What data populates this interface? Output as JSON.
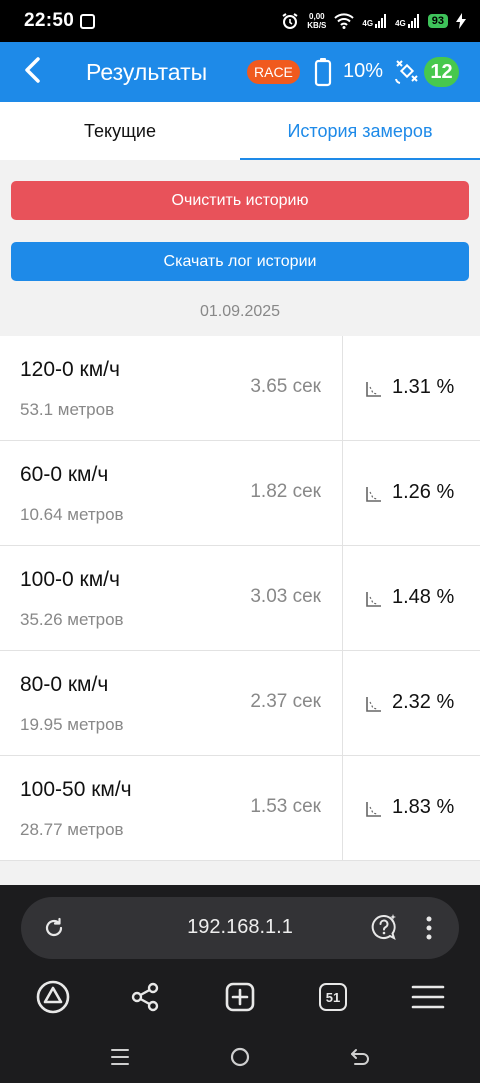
{
  "status_bar": {
    "time": "22:50",
    "net_speed_top": "0,00",
    "net_speed_bottom": "KB/S",
    "net1": "4G",
    "net2": "4G",
    "battery": "93"
  },
  "app_bar": {
    "title": "Результаты",
    "race_badge": "RACE",
    "battery_percent": "10%",
    "satellites": "12"
  },
  "tabs": {
    "current": "Текущие",
    "history": "История замеров"
  },
  "actions": {
    "clear": "Очистить историю",
    "download": "Скачать лог истории"
  },
  "date": "01.09.2025",
  "results": [
    {
      "name": "120-0 км/ч",
      "distance": "53.1 метров",
      "time": "3.65 сек",
      "slope": "1.31 %"
    },
    {
      "name": "60-0 км/ч",
      "distance": "10.64 метров",
      "time": "1.82 сек",
      "slope": "1.26 %"
    },
    {
      "name": "100-0 км/ч",
      "distance": "35.26 метров",
      "time": "3.03 сек",
      "slope": "1.48 %"
    },
    {
      "name": "80-0 км/ч",
      "distance": "19.95 метров",
      "time": "2.37 сек",
      "slope": "2.32 %"
    },
    {
      "name": "100-50 км/ч",
      "distance": "28.77 метров",
      "time": "1.53 сек",
      "slope": "1.83 %"
    }
  ],
  "browser": {
    "url": "192.168.1.1",
    "tab_count": "51"
  },
  "colors": {
    "accent": "#1e8ae8",
    "danger": "#e8525a",
    "race": "#f05a1e",
    "satellite_badge": "#47c84e"
  }
}
